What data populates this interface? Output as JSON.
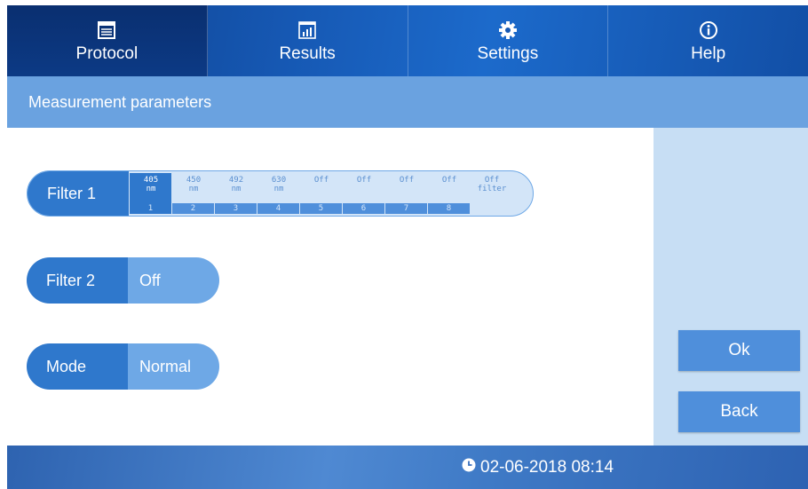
{
  "nav": {
    "tabs": [
      {
        "label": "Protocol",
        "icon": "protocol-icon",
        "active": true
      },
      {
        "label": "Results",
        "icon": "results-chart-icon",
        "active": false
      },
      {
        "label": "Settings",
        "icon": "gear-icon",
        "active": false
      },
      {
        "label": "Help",
        "icon": "info-icon",
        "active": false
      }
    ]
  },
  "page": {
    "title": "Measurement parameters"
  },
  "filter1": {
    "label": "Filter 1",
    "options": [
      {
        "wavelength": "405",
        "unit": "nm",
        "index": "1",
        "selected": true
      },
      {
        "wavelength": "450",
        "unit": "nm",
        "index": "2",
        "selected": false
      },
      {
        "wavelength": "492",
        "unit": "nm",
        "index": "3",
        "selected": false
      },
      {
        "wavelength": "630",
        "unit": "nm",
        "index": "4",
        "selected": false
      },
      {
        "wavelength": "Off",
        "unit": "",
        "index": "5",
        "selected": false
      },
      {
        "wavelength": "Off",
        "unit": "",
        "index": "6",
        "selected": false
      },
      {
        "wavelength": "Off",
        "unit": "",
        "index": "7",
        "selected": false
      },
      {
        "wavelength": "Off",
        "unit": "",
        "index": "8",
        "selected": false
      },
      {
        "wavelength": "Off",
        "unit": "filter",
        "index": "",
        "selected": false
      }
    ]
  },
  "filter2": {
    "label": "Filter 2",
    "value": "Off"
  },
  "mode": {
    "label": "Mode",
    "value": "Normal"
  },
  "actions": {
    "ok_label": "Ok",
    "back_label": "Back"
  },
  "status": {
    "datetime": "02-06-2018 08:14"
  },
  "colors": {
    "nav_dark": "#0c3a85",
    "accent": "#2f78cc",
    "light_accent": "#6ea8e6",
    "panel": "#c7def4"
  }
}
